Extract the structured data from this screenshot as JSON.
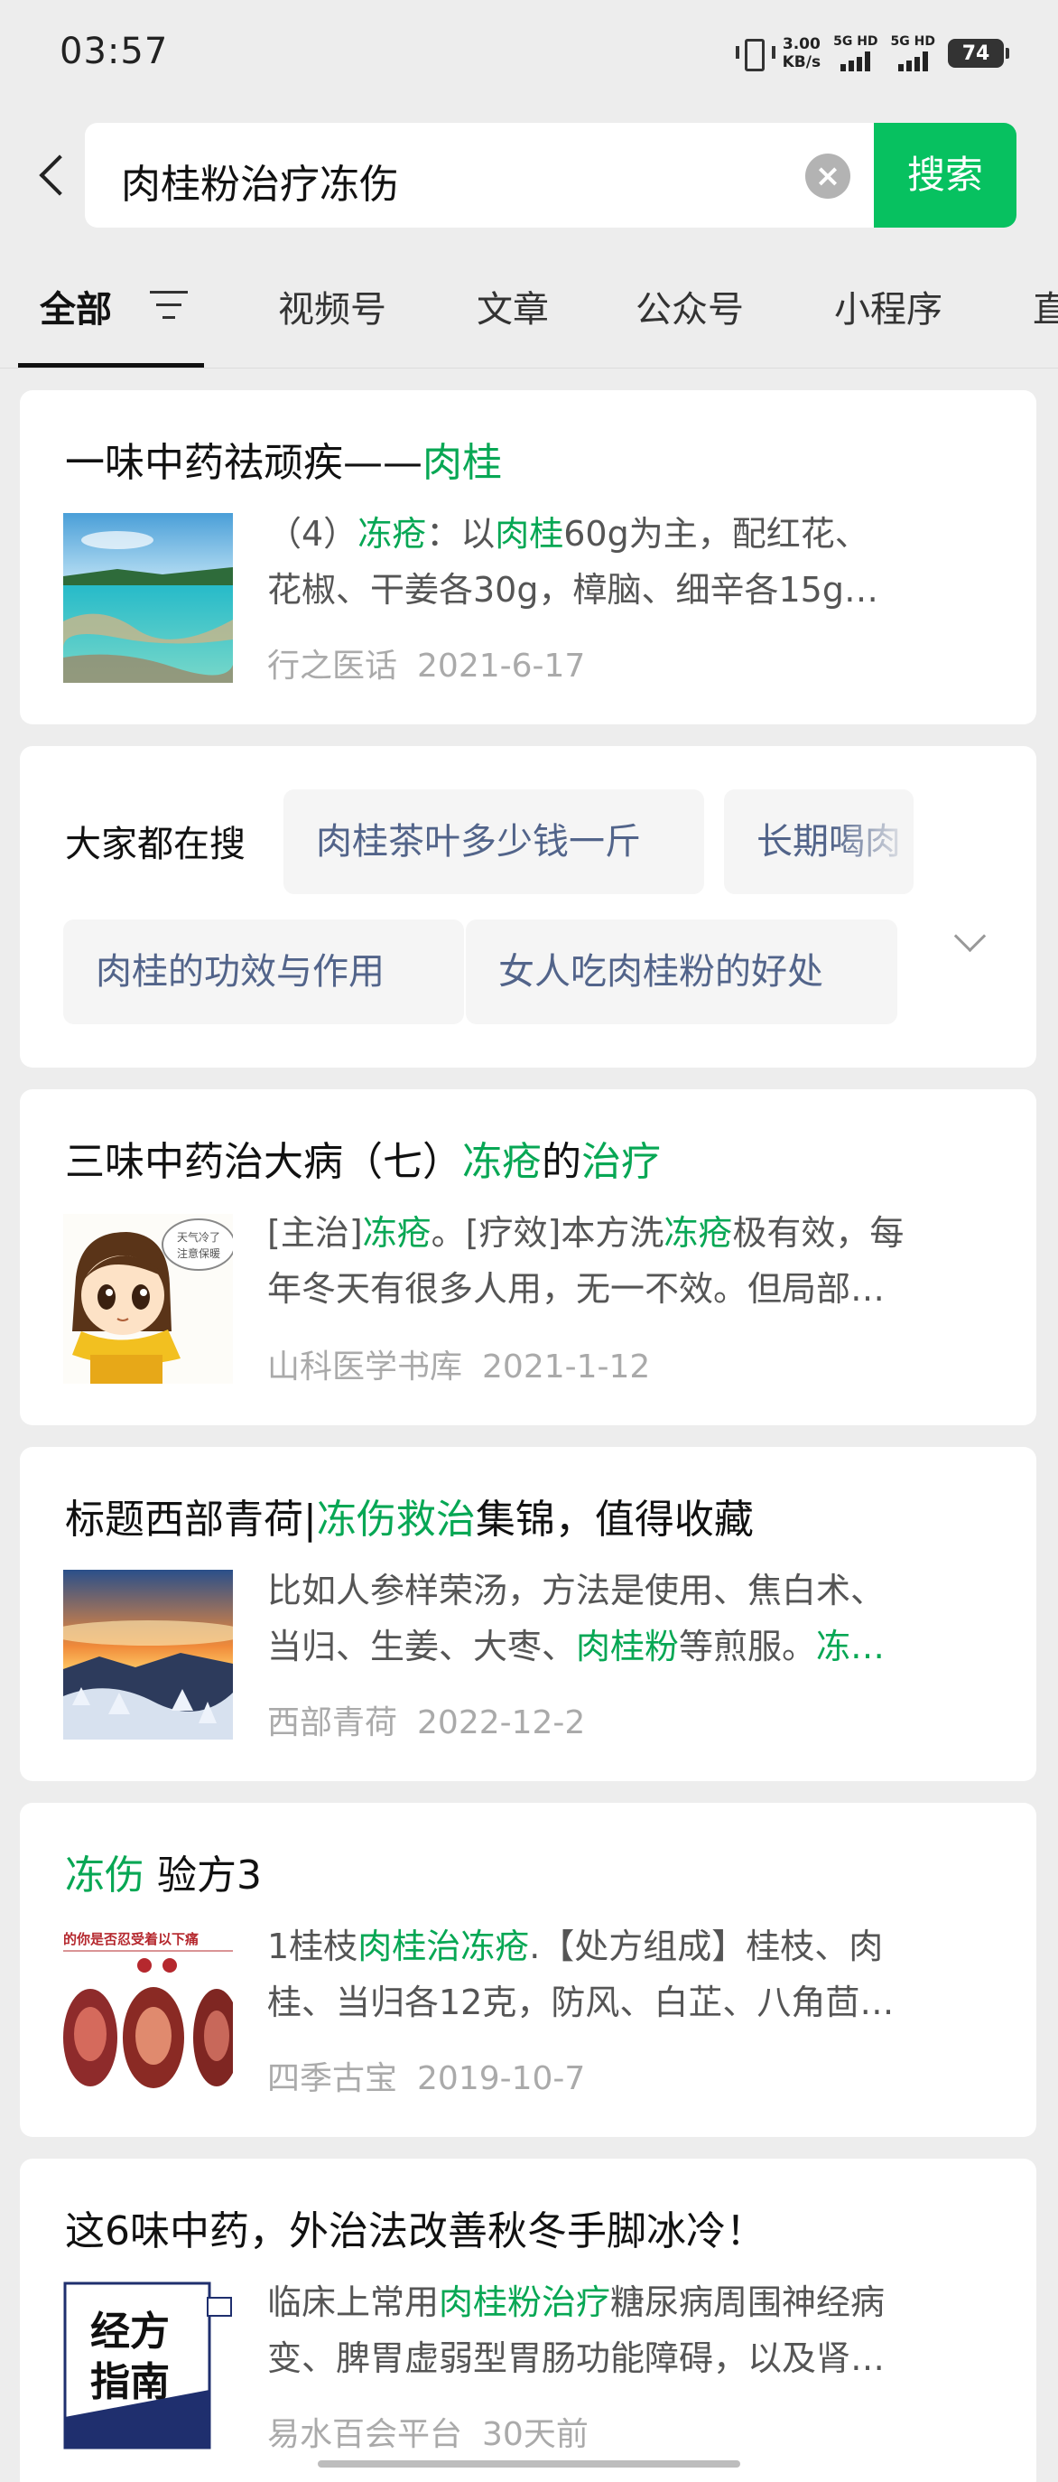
{
  "status": {
    "time": "03:57",
    "net_speed_value": "3.00",
    "net_speed_unit": "KB/s",
    "sim1_label": "5G HD",
    "sim2_label": "5G HD",
    "battery": "74"
  },
  "search": {
    "query": "肉桂粉治疗冻伤",
    "button_label": "搜索"
  },
  "tabs": [
    {
      "label": "全部"
    },
    {
      "label": "视频号"
    },
    {
      "label": "文章"
    },
    {
      "label": "公众号"
    },
    {
      "label": "小程序"
    },
    {
      "label": "直"
    }
  ],
  "results": [
    {
      "title": [
        "一味中药祛顽疾——",
        "肉桂"
      ],
      "snippet_line1": [
        "（4）",
        "冻疮",
        "：以",
        "肉桂",
        "60g为主，配红花、"
      ],
      "snippet_line2": [
        "花椒、干姜各30g，樟脑、细辛各15g…"
      ],
      "source": "行之医话",
      "date": "2021-6-17",
      "thumb_icon": "seascape-thumbnail"
    },
    {
      "title": [
        "三味中药治大病（七）",
        "冻疮",
        "的",
        "治疗"
      ],
      "snippet_line1": [
        "[主治]",
        "冻疮",
        "。[疗效]本方洗",
        "冻疮",
        "极有效，每"
      ],
      "snippet_line2": [
        "年冬天有很多人用，无一不效。但局部…"
      ],
      "source": "山科医学书库",
      "date": "2021-1-12",
      "thumb_icon": "cartoon-girl-thumbnail",
      "thumb_text": "天气冷了 注意保暖"
    },
    {
      "title": [
        "标题西部青荷|",
        "冻伤救治",
        "集锦，值得收藏"
      ],
      "snippet_line1": [
        "比如人参样荣汤，方法是使用、焦白术、"
      ],
      "snippet_line2": [
        "当归、生姜、大枣、",
        "肉桂粉",
        "等煎服。",
        "冻…"
      ],
      "source": "西部青荷",
      "date": "2022-12-2",
      "thumb_icon": "snowy-sunset-thumbnail"
    },
    {
      "title": [
        "冻伤",
        " 验方3"
      ],
      "snippet_line1": [
        "1桂枝",
        "肉桂治冻疮",
        ".【处方组成】桂枝、肉"
      ],
      "snippet_line2": [
        "桂、当归各12克，防风、白芷、八角茴…"
      ],
      "source": "四季古宝",
      "date": "2019-10-7",
      "thumb_icon": "frostbite-photo-thumbnail",
      "thumb_text": "的你是否忍受着以下痛"
    },
    {
      "title": [
        "这6味中药，外治法改善秋冬手脚冰冷！"
      ],
      "snippet_line1": [
        "临床上常用",
        "肉桂粉治疗",
        "糖尿病周围神经病"
      ],
      "snippet_line2": [
        "变、脾胃虚弱型胃肠功能障碍，以及肾…"
      ],
      "source": "易水百会平台",
      "date": "30天前",
      "thumb_icon": "book-cover-thumbnail",
      "thumb_text": [
        "经方",
        "指南"
      ]
    }
  ],
  "hot_searches": {
    "label": "大家都在搜",
    "chips": [
      "肉桂茶叶多少钱一斤",
      "长期喝肉",
      "肉桂的功效与作用",
      "女人吃肉桂粉的好处"
    ]
  },
  "colors": {
    "accent": "#07c160",
    "highlight": "#07a754",
    "chip_text": "#52648a"
  }
}
